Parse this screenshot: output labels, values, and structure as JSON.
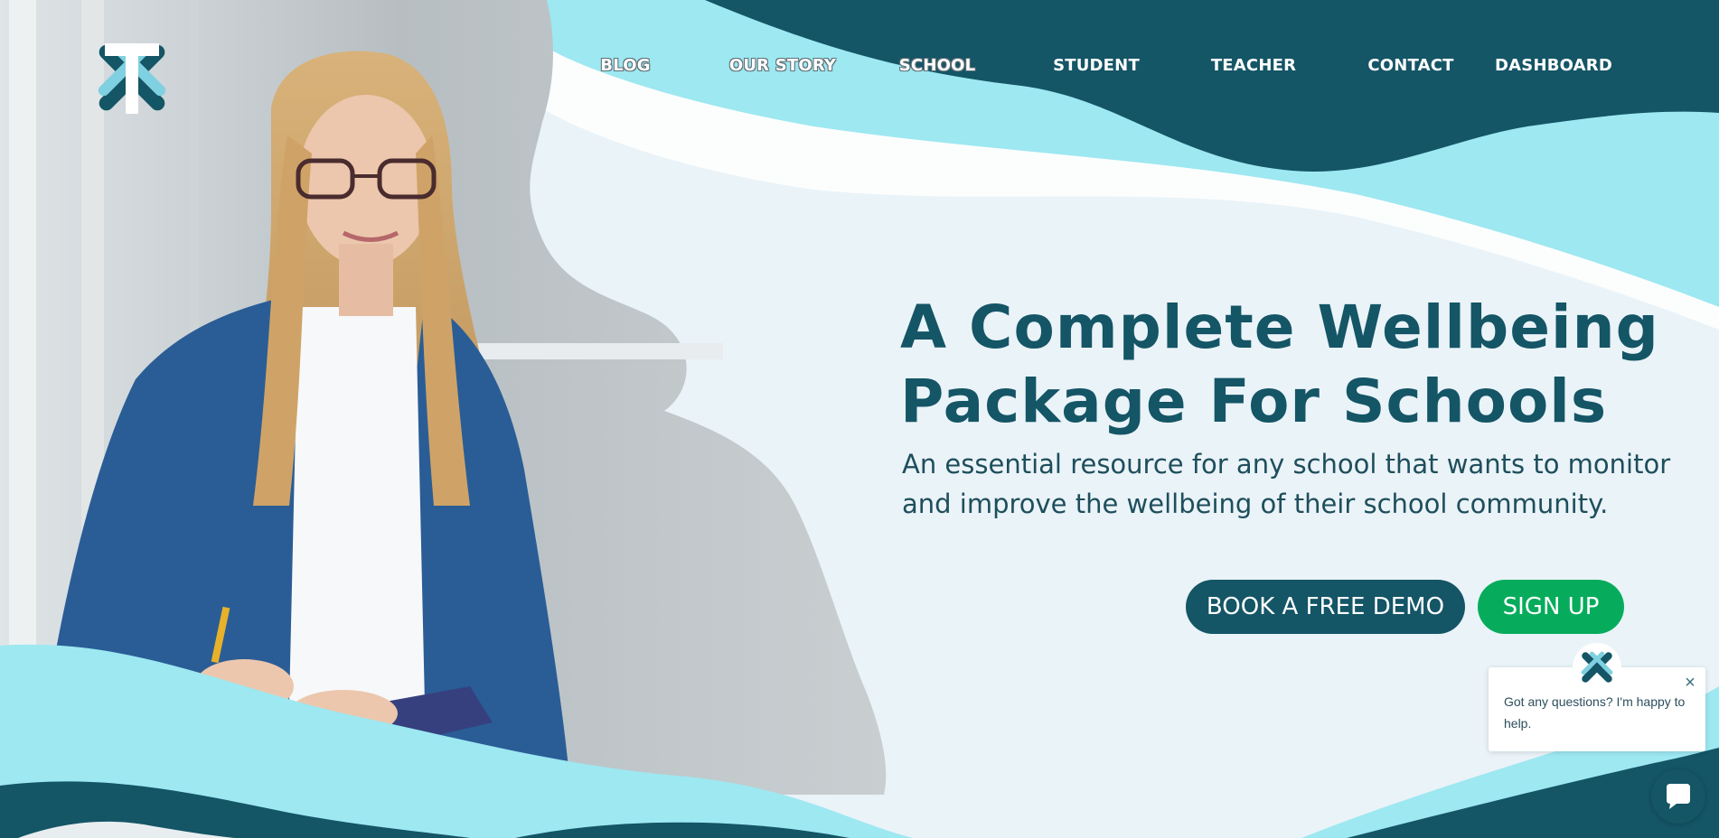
{
  "nav": {
    "items": [
      {
        "label": "BLOG"
      },
      {
        "label": "OUR STORY"
      },
      {
        "label": "SCHOOL"
      },
      {
        "label": "STUDENT"
      },
      {
        "label": "TEACHER"
      },
      {
        "label": "CONTACT"
      },
      {
        "label": "DASHBOARD"
      }
    ]
  },
  "hero": {
    "title_line1": "A Complete Wellbeing",
    "title_line2": "Package For Schools",
    "subtitle_line1": "An essential resource for any school that wants to monitor",
    "subtitle_line2": "and improve the wellbeing of their school community.",
    "demo_button": "BOOK A FREE DEMO",
    "signup_button": "SIGN UP"
  },
  "chat": {
    "message": "Got any questions? I'm happy to help.",
    "close_icon": "close-icon",
    "launcher_icon": "chat-bubble-icon"
  },
  "colors": {
    "primary": "#145566",
    "accent_green": "#06ac5b",
    "cyan": "#9de8f1",
    "background": "#eaf3f8"
  }
}
